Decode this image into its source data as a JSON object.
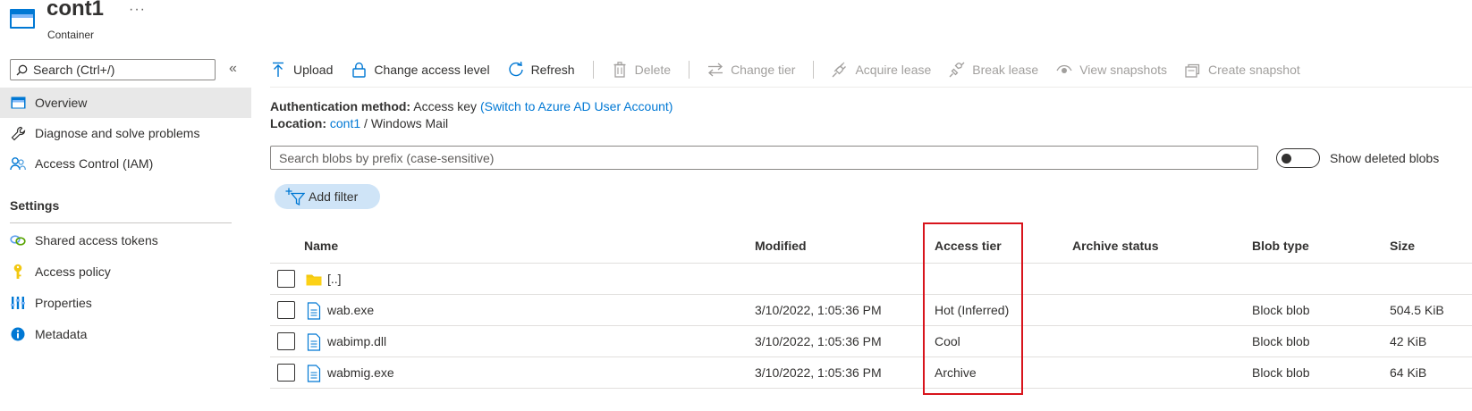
{
  "header": {
    "title": "cont1",
    "subtitle": "Container",
    "more": "···"
  },
  "sidebar": {
    "search_placeholder": "Search (Ctrl+/)",
    "collapse": "«",
    "items": [
      {
        "label": "Overview",
        "icon": "overview-icon"
      },
      {
        "label": "Diagnose and solve problems",
        "icon": "wrench-icon"
      },
      {
        "label": "Access Control (IAM)",
        "icon": "iam-icon"
      }
    ],
    "section_title": "Settings",
    "settings_items": [
      {
        "label": "Shared access tokens",
        "icon": "link-icon"
      },
      {
        "label": "Access policy",
        "icon": "key-icon"
      },
      {
        "label": "Properties",
        "icon": "properties-icon"
      },
      {
        "label": "Metadata",
        "icon": "info-icon"
      }
    ]
  },
  "toolbar": {
    "upload": "Upload",
    "change_access_level": "Change access level",
    "refresh": "Refresh",
    "delete": "Delete",
    "change_tier": "Change tier",
    "acquire_lease": "Acquire lease",
    "break_lease": "Break lease",
    "view_snapshots": "View snapshots",
    "create_snapshot": "Create snapshot"
  },
  "info": {
    "auth_label": "Authentication method:",
    "auth_value": "Access key",
    "auth_link": "(Switch to Azure AD User Account)",
    "location_label": "Location:",
    "location_link": "cont1",
    "location_sep": "/",
    "location_path": "Windows Mail"
  },
  "blob_search": {
    "placeholder": "Search blobs by prefix (case-sensitive)"
  },
  "show_deleted": {
    "label": "Show deleted blobs",
    "enabled": false
  },
  "add_filter": "Add filter",
  "table": {
    "columns": [
      "Name",
      "Modified",
      "Access tier",
      "Archive status",
      "Blob type",
      "Size"
    ],
    "parent_row": "[..]",
    "rows": [
      {
        "name": "wab.exe",
        "modified": "3/10/2022, 1:05:36 PM",
        "access_tier": "Hot (Inferred)",
        "archive_status": "",
        "blob_type": "Block blob",
        "size": "504.5 KiB"
      },
      {
        "name": "wabimp.dll",
        "modified": "3/10/2022, 1:05:36 PM",
        "access_tier": "Cool",
        "archive_status": "",
        "blob_type": "Block blob",
        "size": "42 KiB"
      },
      {
        "name": "wabmig.exe",
        "modified": "3/10/2022, 1:05:36 PM",
        "access_tier": "Archive",
        "archive_status": "",
        "blob_type": "Block blob",
        "size": "64 KiB"
      }
    ]
  },
  "colors": {
    "accent": "#0078d4",
    "highlight": "#d8141c",
    "folder": "#f2c811"
  }
}
